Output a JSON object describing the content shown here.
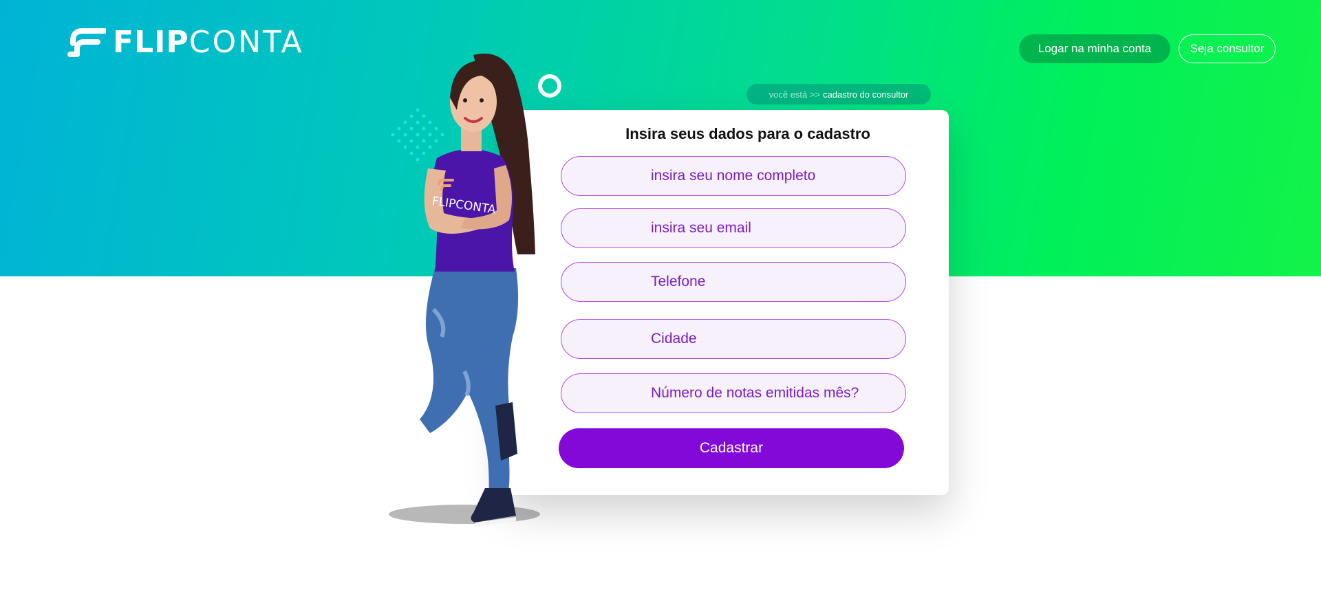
{
  "header": {
    "logo": {
      "bold": "FLIP",
      "light": "CONTA"
    },
    "login_button": "Logar na minha conta",
    "consultor_button": "Seja consultor"
  },
  "breadcrumb": {
    "prefix": "você está >>",
    "current": "cadastro do consultor"
  },
  "form": {
    "title": "Insira seus dados para o cadastro",
    "fields": [
      {
        "placeholder": "insira seu nome completo"
      },
      {
        "placeholder": "insira seu email"
      },
      {
        "placeholder": "Telefone"
      },
      {
        "placeholder": "Cidade"
      },
      {
        "placeholder": "Número de notas emitidas mês?"
      }
    ],
    "submit_label": "Cadastrar"
  },
  "figure": {
    "shirt_text": "FLIPCONTA"
  },
  "colors": {
    "gradient_start": "#00b3d6",
    "gradient_end": "#13f249",
    "login_bg": "#00b54d",
    "accent_purple": "#8309d8",
    "field_border": "#b24ae0"
  }
}
